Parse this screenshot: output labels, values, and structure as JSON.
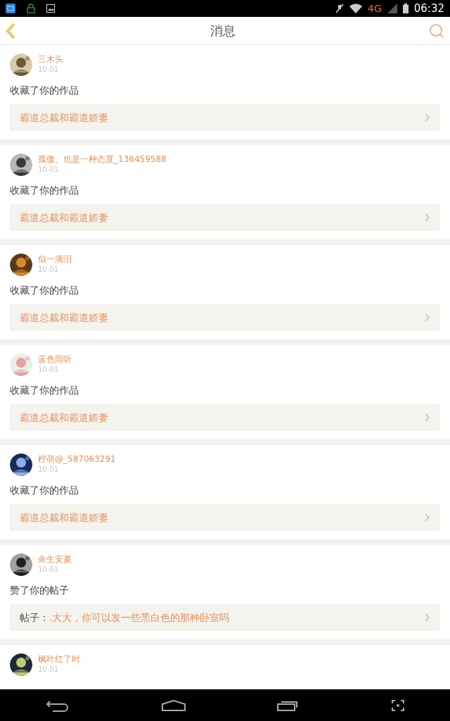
{
  "status_bar": {
    "network": "4G",
    "time": "06:32"
  },
  "header": {
    "title": "消息"
  },
  "messages": [
    {
      "user": "三木头",
      "date": "10-01",
      "action": "收藏了你的作品",
      "link": {
        "title": "霸道总裁和霸道娇妻"
      }
    },
    {
      "user": "孤傲、也是一种态度_136459588",
      "date": "10-01",
      "action": "收藏了你的作品",
      "link": {
        "title": "霸道总裁和霸道娇妻"
      }
    },
    {
      "user": "似一滴泪",
      "date": "10-01",
      "action": "收藏了你的作品",
      "link": {
        "title": "霸道总裁和霸道娇妻"
      }
    },
    {
      "user": "蓝色雨听",
      "date": "10-01",
      "action": "收藏了你的作品",
      "link": {
        "title": "霸道总裁和霸道娇妻"
      }
    },
    {
      "user": "柠萌@_587063291",
      "date": "10-01",
      "action": "收藏了你的作品",
      "link": {
        "title": "霸道总裁和霸道娇妻"
      }
    },
    {
      "user": "余生安夏",
      "date": "10-01",
      "action": "赞了你的帖子",
      "link": {
        "prefix": "帖子：",
        "title": ".大大，你可以发一些黑白色的那种卧室吗"
      }
    },
    {
      "user": "枫叶红了时",
      "date": "10-01"
    }
  ]
}
